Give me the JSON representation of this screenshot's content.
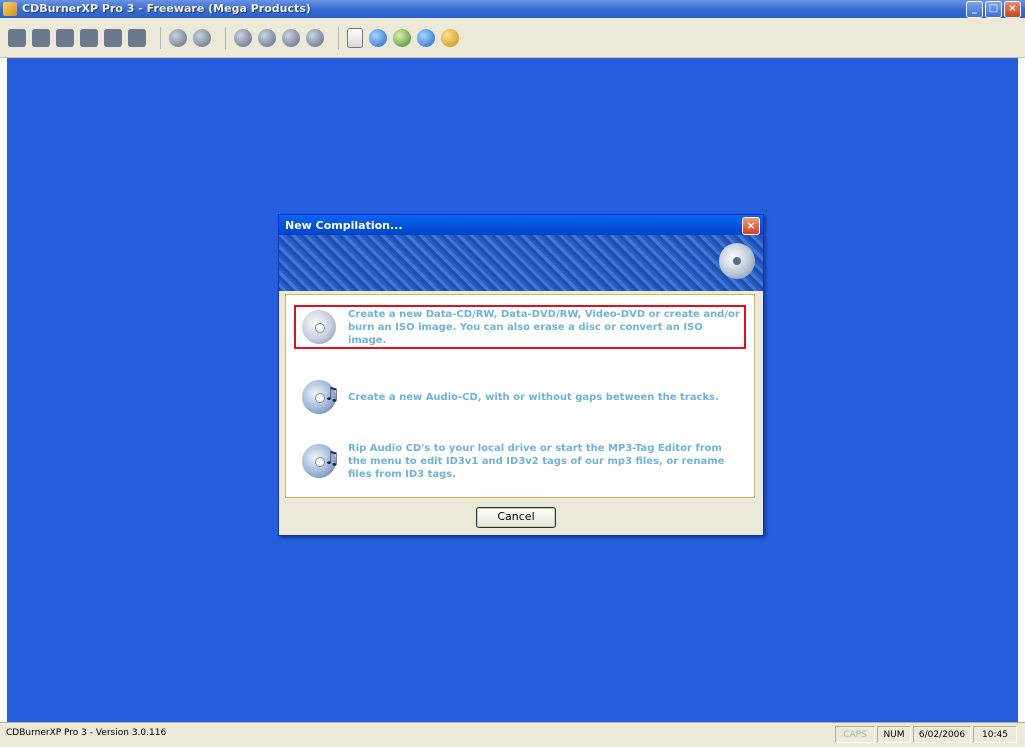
{
  "window": {
    "title": "CDBurnerXP Pro 3 - Freeware (Mega Products)"
  },
  "dialog": {
    "title": "New Compilation...",
    "options": [
      {
        "text": "Create a new Data-CD/RW, Data-DVD/RW, Video-DVD or create and/or burn an ISO image. You can also erase a disc or convert an ISO image.",
        "icon": "data-disc-icon",
        "selected": true
      },
      {
        "text": "Create a new Audio-CD, with or without gaps between the tracks.",
        "icon": "audio-cd-icon",
        "selected": false
      },
      {
        "text": "Rip Audio CD's to your local drive or start the MP3-Tag Editor from the menu to edit ID3v1 and ID3v2 tags of our mp3 files, or rename files from ID3 tags.",
        "icon": "music-rip-icon",
        "selected": false
      }
    ],
    "cancel_label": "Cancel"
  },
  "statusbar": {
    "version": "CDBurnerXP Pro 3 - Version 3.0.116",
    "caps": "CAPS",
    "num": "NUM",
    "date": "6/02/2006",
    "time": "10:45"
  },
  "colors": {
    "desktop": "#245edc",
    "title_bar": "#0a64f0",
    "option_text": "#6fb2dd",
    "selection_border": "#e01020"
  }
}
